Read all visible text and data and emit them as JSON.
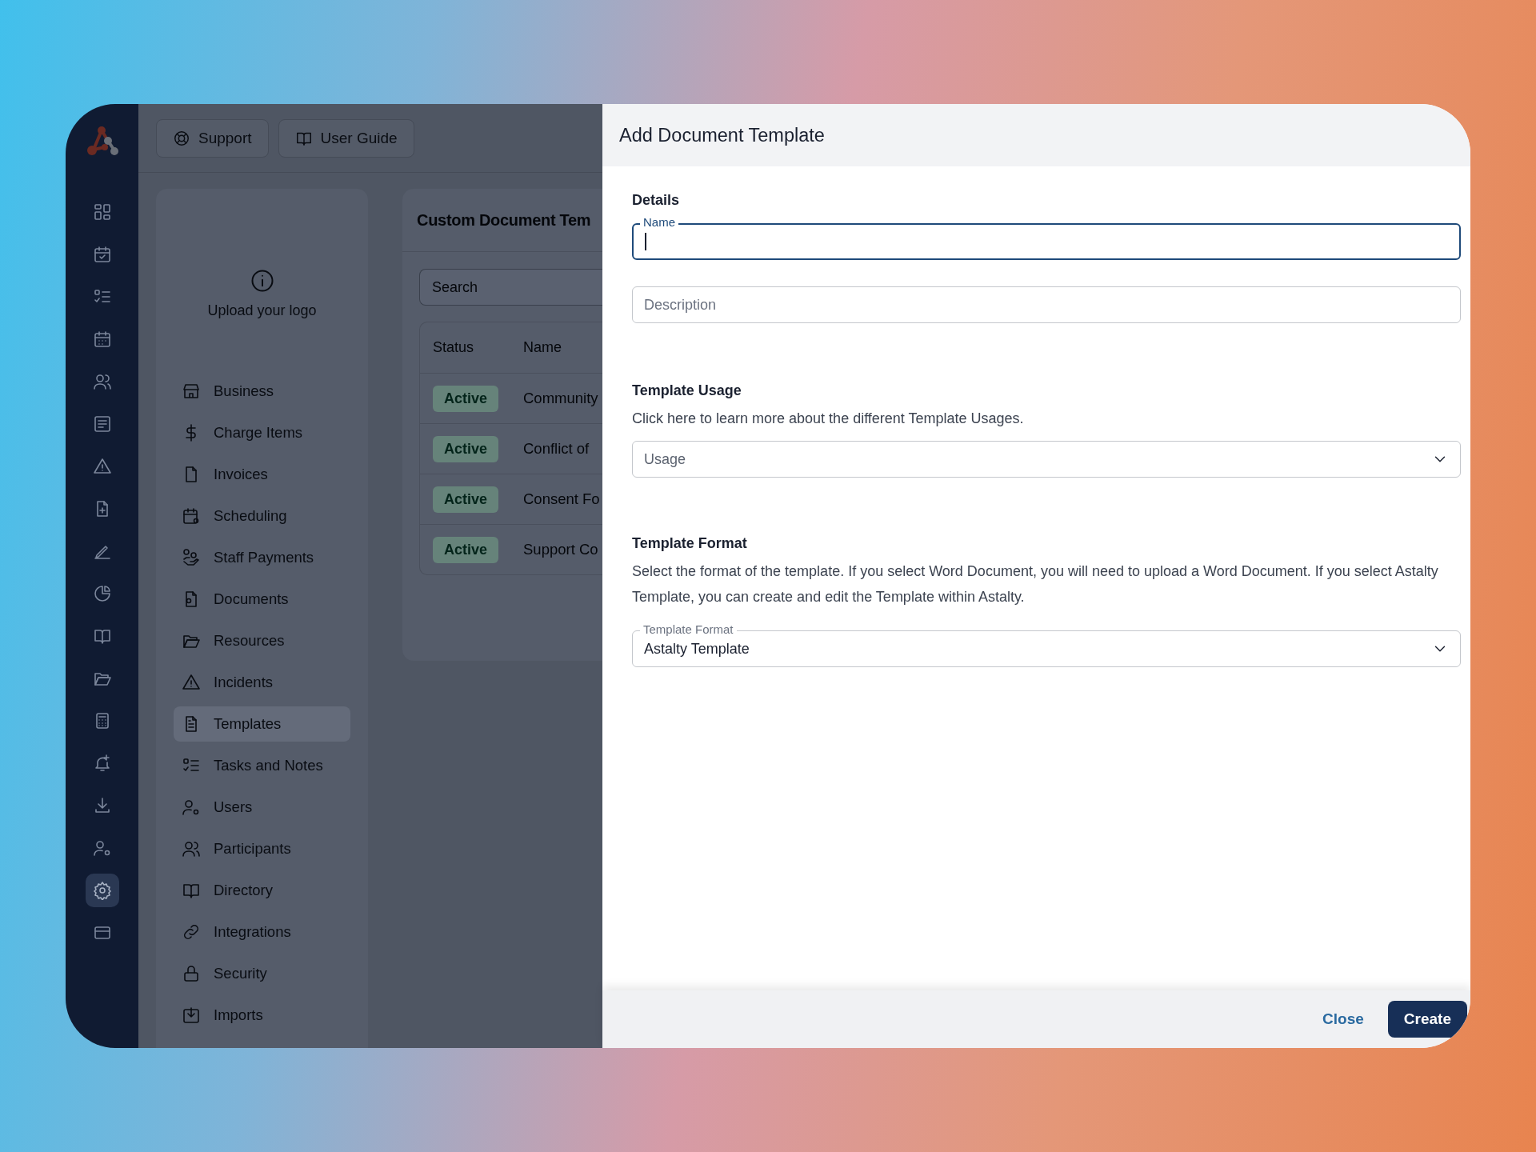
{
  "rail": {
    "items": [
      {
        "selected": false
      },
      {
        "selected": false
      },
      {
        "selected": false
      },
      {
        "selected": false
      },
      {
        "selected": false
      },
      {
        "selected": false
      },
      {
        "selected": false
      },
      {
        "selected": false
      },
      {
        "selected": false
      },
      {
        "selected": false
      },
      {
        "selected": false
      },
      {
        "selected": false
      },
      {
        "selected": false
      },
      {
        "selected": false
      },
      {
        "selected": false
      },
      {
        "selected": false
      },
      {
        "selected": true
      },
      {
        "selected": false
      }
    ]
  },
  "topbar": {
    "buttons": [
      "Support",
      "User Guide"
    ]
  },
  "settings_nav": {
    "logo_prompt": "Upload your logo",
    "items": [
      {
        "label": "Business",
        "selected": false
      },
      {
        "label": "Charge Items",
        "selected": false
      },
      {
        "label": "Invoices",
        "selected": false
      },
      {
        "label": "Scheduling",
        "selected": false
      },
      {
        "label": "Staff Payments",
        "selected": false
      },
      {
        "label": "Documents",
        "selected": false
      },
      {
        "label": "Resources",
        "selected": false
      },
      {
        "label": "Incidents",
        "selected": false
      },
      {
        "label": "Templates",
        "selected": true
      },
      {
        "label": "Tasks and Notes",
        "selected": false
      },
      {
        "label": "Users",
        "selected": false
      },
      {
        "label": "Participants",
        "selected": false
      },
      {
        "label": "Directory",
        "selected": false
      },
      {
        "label": "Integrations",
        "selected": false
      },
      {
        "label": "Security",
        "selected": false
      },
      {
        "label": "Imports",
        "selected": false
      }
    ]
  },
  "templates_card": {
    "title": "Custom Document Tem",
    "search": {
      "placeholder": "Search"
    },
    "table": {
      "columns": [
        "Status",
        "Name"
      ],
      "rows": [
        {
          "status": "Active",
          "name": "Community"
        },
        {
          "status": "Active",
          "name": "Conflict of"
        },
        {
          "status": "Active",
          "name": "Consent Fo"
        },
        {
          "status": "Active",
          "name": "Support Co"
        }
      ]
    }
  },
  "dialog": {
    "title": "Add Document Template",
    "details": {
      "heading": "Details",
      "name_field": {
        "label": "Name",
        "focused": true
      },
      "description_field": {
        "placeholder": "Description"
      }
    },
    "usage": {
      "heading": "Template Usage",
      "help": "Click here to learn more about the different Template Usages.",
      "select": {
        "placeholder": "Usage"
      }
    },
    "format": {
      "heading": "Template Format",
      "help": "Select the format of the template. If you select Word Document, you will need to upload a Word Document. If you select Astalty Template, you can create and edit the Template within Astalty.",
      "select": {
        "label": "Template Format",
        "value": "Astalty Template"
      }
    },
    "buttons": [
      {
        "label": "Close",
        "kind": "link"
      },
      {
        "label": "Create",
        "kind": "primary"
      }
    ]
  }
}
